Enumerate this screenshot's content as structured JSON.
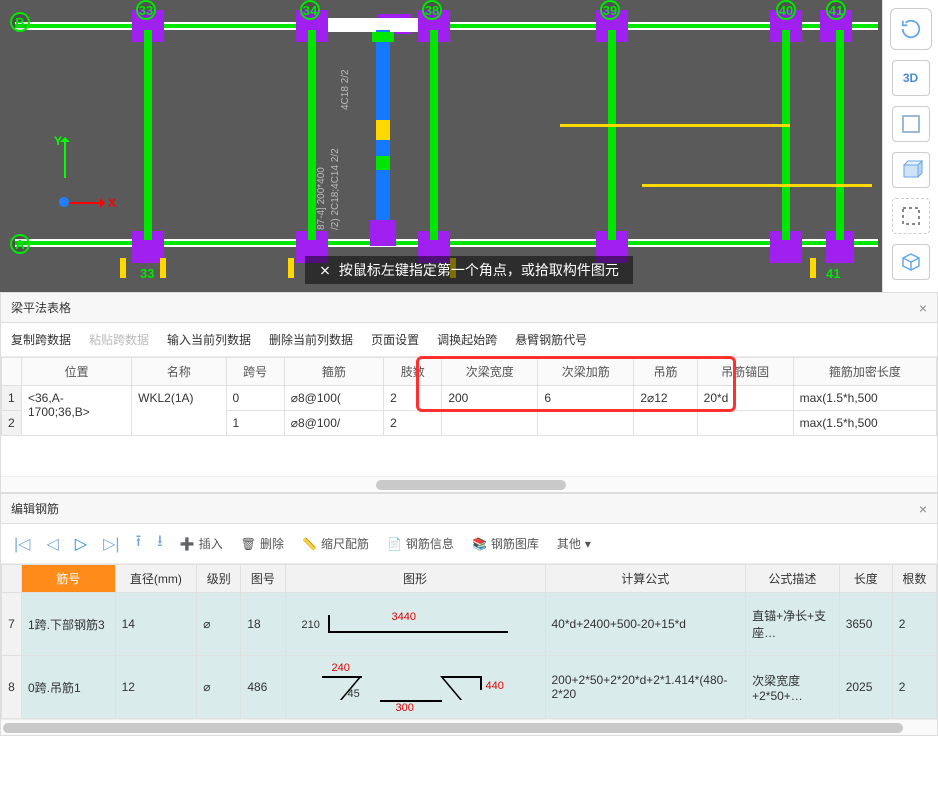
{
  "canvas": {
    "hint": "按鼠标左键指定第一个角点，或拾取构件图元",
    "axes": {
      "y": "Y",
      "x": "X"
    },
    "top_labels": {
      "B": "B",
      "n33": "33",
      "n34": "34",
      "n38": "38",
      "n39": "39",
      "n40": "40",
      "n41": "41"
    },
    "bottom_labels": {
      "A": "A",
      "n33": "33",
      "n41": "41"
    },
    "annot": {
      "t1": "4C18 2/2",
      "t2": "87-4] 200*400",
      "t3": "/2) 2C18;4C14 2/2"
    }
  },
  "right_tools": {
    "rotate": "↻",
    "cube3d": "3D",
    "cube": "◻",
    "cube2": "◧",
    "brackets": "⛶",
    "box": "◫"
  },
  "beam_panel": {
    "title": "梁平法表格",
    "toolbar": {
      "copy": "复制跨数据",
      "paste": "粘贴跨数据",
      "input": "输入当前列数据",
      "delete": "删除当前列数据",
      "page": "页面设置",
      "switch": "调换起始跨",
      "cant": "悬臂钢筋代号"
    },
    "headers": {
      "pos": "位置",
      "name": "名称",
      "span": "跨号",
      "stirrup": "箍筋",
      "legs": "肢数",
      "subw": "次梁宽度",
      "subadd": "次梁加筋",
      "hang": "吊筋",
      "anchor": "吊筋锚固",
      "dense": "箍筋加密长度"
    },
    "rows": [
      {
        "idx": "1",
        "pos": "<36,A-1700;36,B>",
        "name": "WKL2(1A)",
        "span": "0",
        "stirrup": "⌀8@100(",
        "legs": "2",
        "subw": "200",
        "subadd": "6",
        "hang": "2⌀12",
        "anchor": "20*d",
        "dense": "max(1.5*h,500"
      },
      {
        "idx": "2",
        "pos": "",
        "name": "",
        "span": "1",
        "stirrup": "⌀8@100/",
        "legs": "2",
        "subw": "",
        "subadd": "",
        "hang": "",
        "anchor": "",
        "dense": "max(1.5*h,500"
      }
    ]
  },
  "edit_panel": {
    "title": "编辑钢筋",
    "toolbar": {
      "insert": "插入",
      "delete": "删除",
      "scale": "缩尺配筋",
      "info": "钢筋信息",
      "lib": "钢筋图库",
      "other": "其他"
    },
    "headers": {
      "num": "筋号",
      "dia": "直径(mm)",
      "grade": "级别",
      "fig": "图号",
      "shape": "图形",
      "formula": "计算公式",
      "desc": "公式描述",
      "len": "长度",
      "qty": "根数"
    },
    "rows": [
      {
        "idx": "7",
        "num": "1跨.下部钢筋3",
        "dia": "14",
        "grade": "⌀",
        "fig": "18",
        "shape": {
          "left": "210",
          "top": "3440"
        },
        "formula": "40*d+2400+500-20+15*d",
        "desc": "直锚+净长+支座…",
        "len": "3650",
        "qty": "2"
      },
      {
        "idx": "8",
        "num": "0跨.吊筋1",
        "dia": "12",
        "grade": "⌀",
        "fig": "486",
        "shape": {
          "tl": "240",
          "bl": "45",
          "bc": "300",
          "tr": "440"
        },
        "formula": "200+2*50+2*20*d+2*1.414*(480-2*20",
        "desc": "次梁宽度+2*50+…",
        "len": "2025",
        "qty": "2"
      }
    ]
  }
}
